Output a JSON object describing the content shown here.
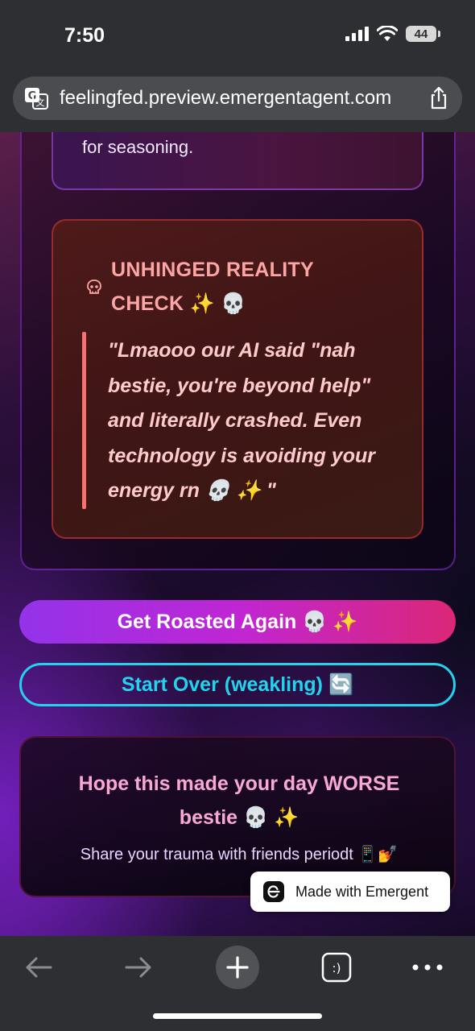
{
  "status_bar": {
    "time": "7:50",
    "battery": "44"
  },
  "browser": {
    "url": "feelingfed.preview.emergentagent.com"
  },
  "page": {
    "top_card_text": "for seasoning.",
    "reality_check": {
      "title": "UNHINGED REALITY CHECK ✨ 💀",
      "quote": "\"Lmaooo our AI said \"nah bestie, you're beyond help\" and literally crashed. Even technology is avoiding your energy rn 💀 ✨ \""
    },
    "buttons": {
      "roast_again": "Get Roasted Again 💀 ✨",
      "start_over": "Start Over (weakling) 🔄"
    },
    "bottom_card": {
      "title": "Hope this made your day WORSE bestie 💀 ✨",
      "subtitle": "Share your trauma with friends periodt 📱💅"
    },
    "badge": "Made with Emergent"
  },
  "colors": {
    "accent_pink": "#db2777",
    "accent_purple": "#9333ea",
    "accent_cyan": "#22d3ee",
    "reality_title": "#fca5a5"
  }
}
